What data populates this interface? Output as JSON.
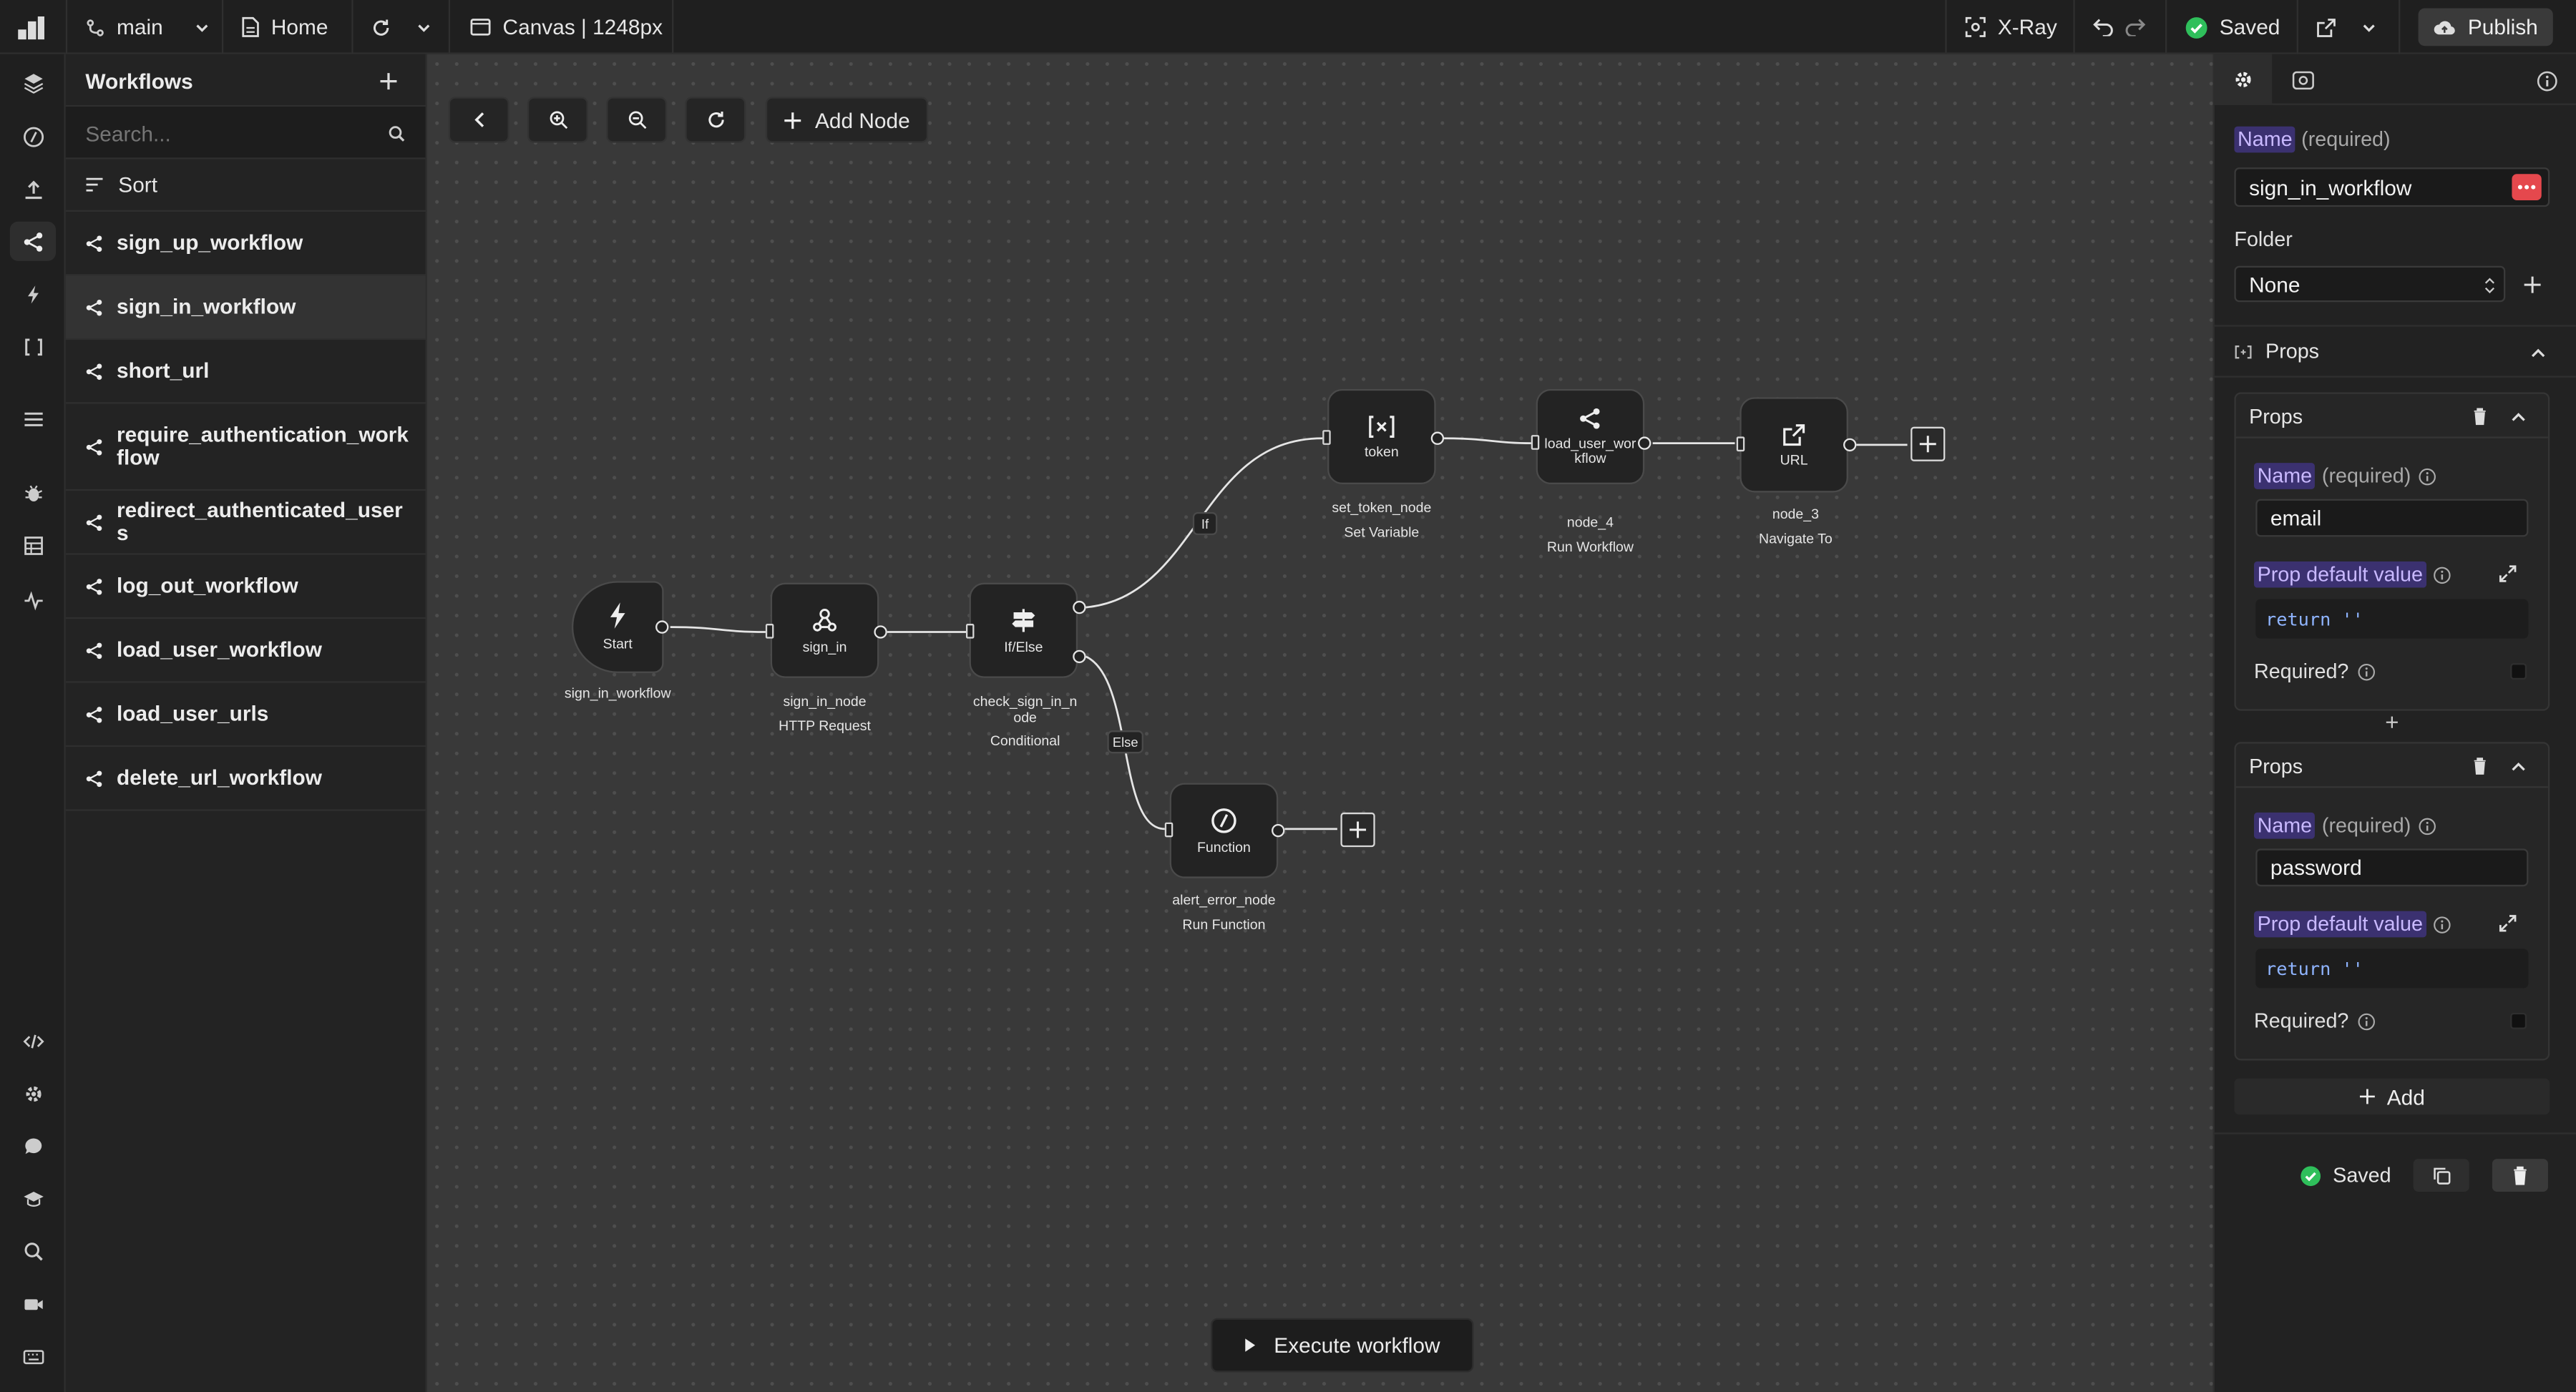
{
  "topbar": {
    "branch": "main",
    "page": "Home",
    "canvas_label": "Canvas | 1248px",
    "xray": "X-Ray",
    "saved": "Saved",
    "publish": "Publish"
  },
  "workflows": {
    "title": "Workflows",
    "search_placeholder": "Search...",
    "sort": "Sort",
    "items": [
      {
        "label": "sign_up_workflow"
      },
      {
        "label": "sign_in_workflow",
        "selected": true
      },
      {
        "label": "short_url"
      },
      {
        "label": "require_authentication_workflow"
      },
      {
        "label": "redirect_authenticated_users"
      },
      {
        "label": "log_out_workflow"
      },
      {
        "label": "load_user_workflow"
      },
      {
        "label": "load_user_urls"
      },
      {
        "label": "delete_url_workflow"
      }
    ]
  },
  "canvas": {
    "add_node": "Add Node",
    "execute": "Execute workflow",
    "edge_if": "If",
    "edge_else": "Else",
    "nodes": {
      "start": {
        "label": "Start",
        "caption": "sign_in_workflow"
      },
      "sign_in": {
        "label": "sign_in",
        "caption": "sign_in_node",
        "type": "HTTP Request"
      },
      "ifelse": {
        "label": "If/Else",
        "caption": "check_sign_in_node",
        "type": "Conditional"
      },
      "token": {
        "label": "token",
        "caption": "set_token_node",
        "type": "Set Variable"
      },
      "load_user": {
        "label": "load_user_workflow",
        "caption": "node_4",
        "type": "Run Workflow"
      },
      "url": {
        "label": "URL",
        "caption": "node_3",
        "type": "Navigate To"
      },
      "function": {
        "label": "Function",
        "caption": "alert_error_node",
        "type": "Run Function"
      }
    }
  },
  "inspector": {
    "name_label": "Name",
    "required": "(required)",
    "name_value": "sign_in_workflow",
    "folder_label": "Folder",
    "folder_value": "None",
    "props_section": "Props",
    "props": [
      {
        "title": "Props",
        "name_label": "Name",
        "name_required": "(required)",
        "name_value": "email",
        "default_label": "Prop default value",
        "default_code": "return ''",
        "required_q": "Required?"
      },
      {
        "title": "Props",
        "name_label": "Name",
        "name_required": "(required)",
        "name_value": "password",
        "default_label": "Prop default value",
        "default_code": "return ''",
        "required_q": "Required?"
      }
    ],
    "add": "Add",
    "footer_saved": "Saved"
  },
  "colors": {
    "accent_purple": "#c9b9ff",
    "saved_green": "#2fbf5b",
    "error_red": "#e5484d",
    "canvas_bg": "#393939"
  }
}
